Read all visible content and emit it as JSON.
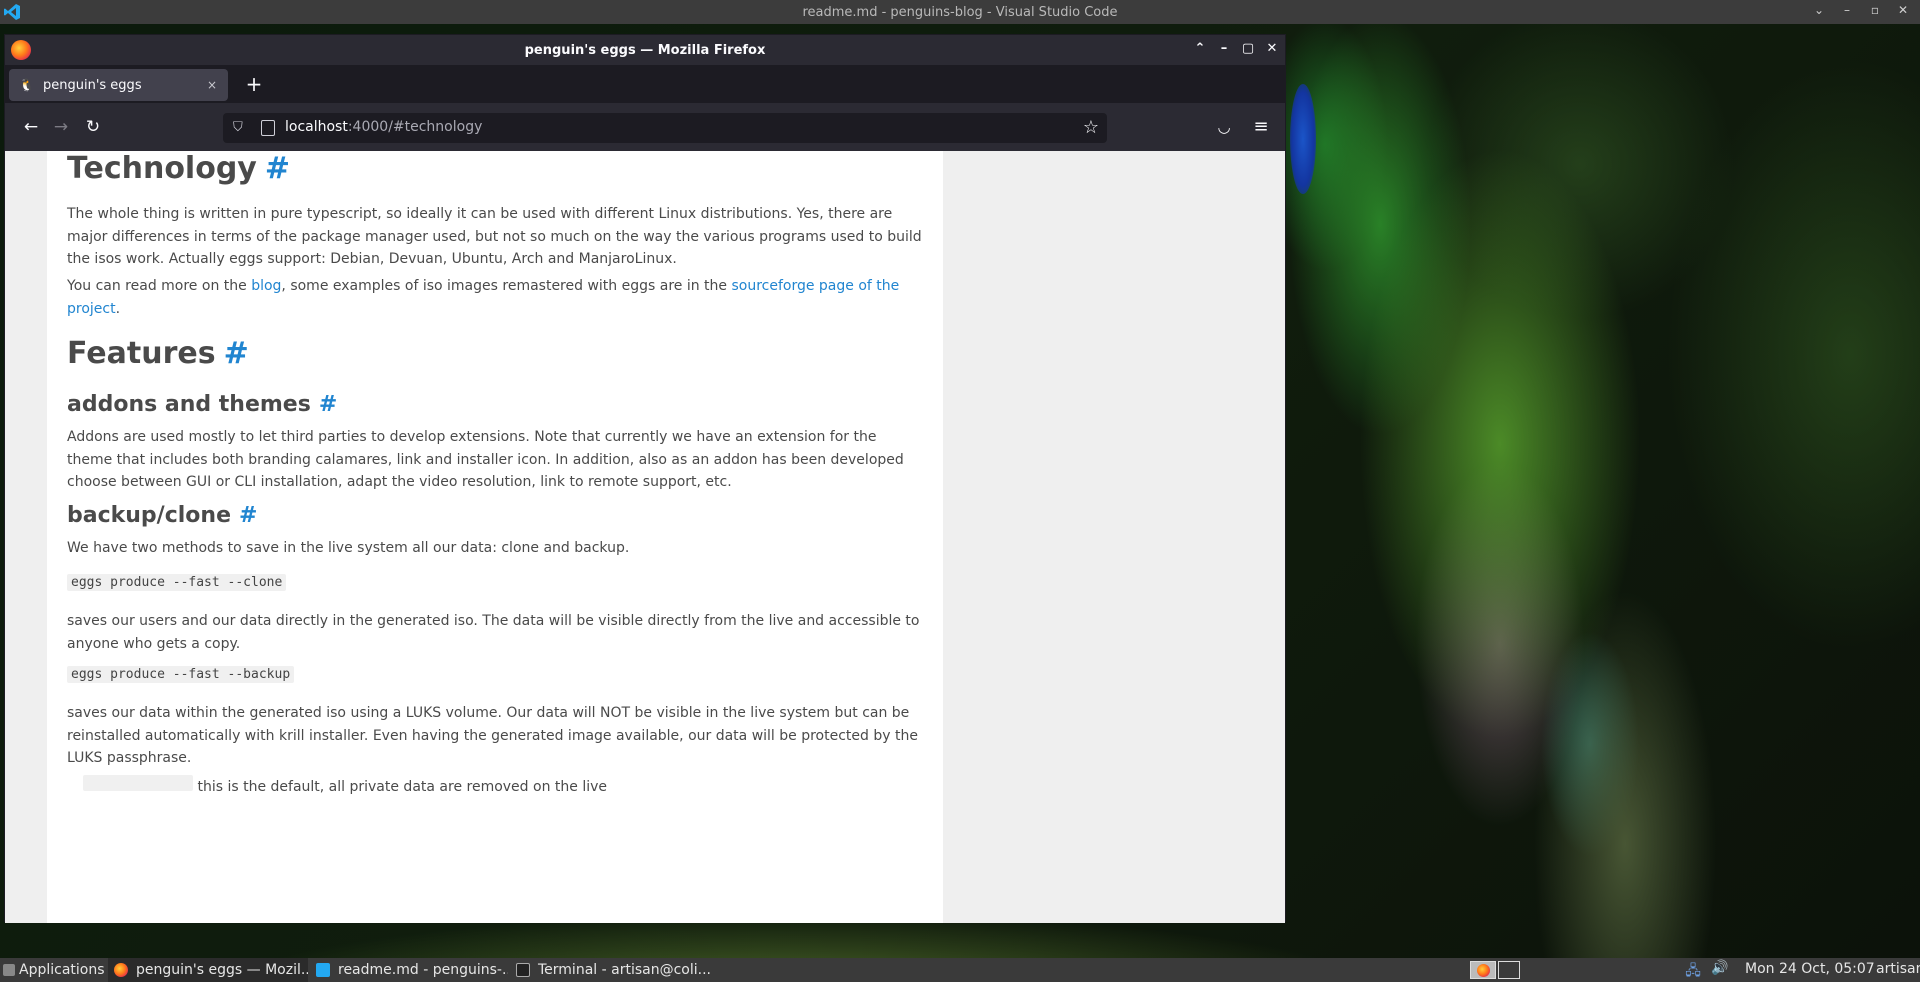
{
  "vscode": {
    "window_title": "readme.md - penguins-blog - Visual Studio Code"
  },
  "firefox": {
    "window_title": "penguin's eggs — Mozilla Firefox",
    "tab": {
      "title": "penguin's eggs",
      "close": "×"
    },
    "new_tab": "+",
    "url": {
      "host": "localhost",
      "path": ":4000/#technology"
    }
  },
  "article": {
    "technology_heading": "Technology",
    "hash": "#",
    "technology_p1": "The whole thing is written in pure typescript, so ideally it can be used with different Linux distributions. Yes, there are major differences in terms of the package manager used, but not so much on the way the various programs used to build the isos work. Actually eggs support: Debian, Devuan, Ubuntu, Arch and ManjaroLinux.",
    "technology_p2": {
      "before": "You can read more on the ",
      "blog_link": "blog",
      "middle": ", some examples of iso images remastered with eggs are in the ",
      "sourceforge_link": "sourceforge page of the project",
      "after": "."
    },
    "features_heading": "Features",
    "addons_heading": "addons and themes",
    "addons_p": "Addons are used mostly to let third parties to develop extensions. Note that currently we have an extension for the theme that includes both branding calamares, link and installer icon. In addition, also as an addon has been developed choose between GUI or CLI installation, adapt the video resolution, link to remote support, etc.",
    "backup_heading": "backup/clone",
    "backup_p1": "We have two methods to save in the live system all our data: clone and backup.",
    "code_clone": "eggs produce --fast --clone",
    "clone_p": "saves our users and our data directly in the generated iso. The data will be visible directly from the live and accessible to anyone who gets a copy.",
    "code_backup": "eggs produce --fast --backup",
    "backup_p2": "saves our data within the generated iso using a LUKS volume. Our data will NOT be visible in the live system but can be reinstalled automatically with krill installer. Even having the generated image available, our data will be protected by the LUKS passphrase.",
    "cutoff_text": "this is the default, all private data are removed on the live"
  },
  "taskbar": {
    "applications": "Applications :",
    "firefox": "penguin's eggs — Mozil...",
    "vscode": "readme.md - penguins-...",
    "terminal": "Terminal - artisan@coli...",
    "clock": "Mon 24 Oct, 05:07",
    "user": "artisan"
  }
}
